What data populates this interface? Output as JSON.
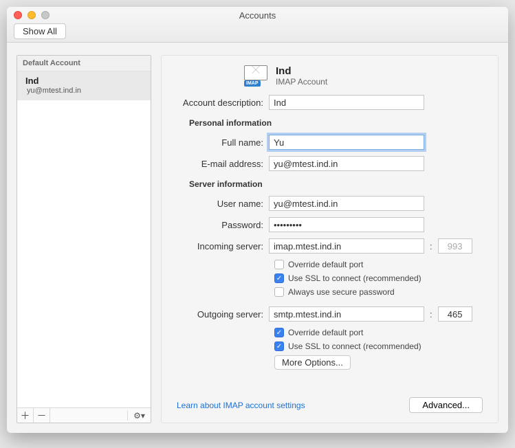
{
  "window": {
    "title": "Accounts",
    "show_all": "Show All"
  },
  "sidebar": {
    "header": "Default Account",
    "account": {
      "name": "Ind",
      "email": "yu@mtest.ind.in"
    },
    "footer": {
      "add": "＋",
      "remove": "－",
      "gear": "⚙▾"
    }
  },
  "main": {
    "header": {
      "name": "Ind",
      "type": "IMAP Account",
      "badge": "IMAP"
    },
    "labels": {
      "description": "Account description:",
      "full_name": "Full name:",
      "email": "E-mail address:",
      "user": "User name:",
      "password": "Password:",
      "incoming": "Incoming server:",
      "outgoing": "Outgoing server:"
    },
    "sections": {
      "personal": "Personal information",
      "server": "Server information"
    },
    "values": {
      "description": "Ind",
      "full_name": "Yu",
      "email": "yu@mtest.ind.in",
      "user": "yu@mtest.ind.in",
      "password": "•••••••••",
      "incoming": "imap.mtest.ind.in",
      "incoming_port": "993",
      "outgoing": "smtp.mtest.ind.in",
      "outgoing_port": "465"
    },
    "checkboxes": {
      "override_in": "Override default port",
      "ssl_in": "Use SSL to connect (recommended)",
      "secure_pw": "Always use secure password",
      "override_out": "Override default port",
      "ssl_out": "Use SSL to connect (recommended)"
    },
    "buttons": {
      "more_options": "More Options...",
      "advanced": "Advanced..."
    },
    "link": "Learn about IMAP account settings"
  }
}
